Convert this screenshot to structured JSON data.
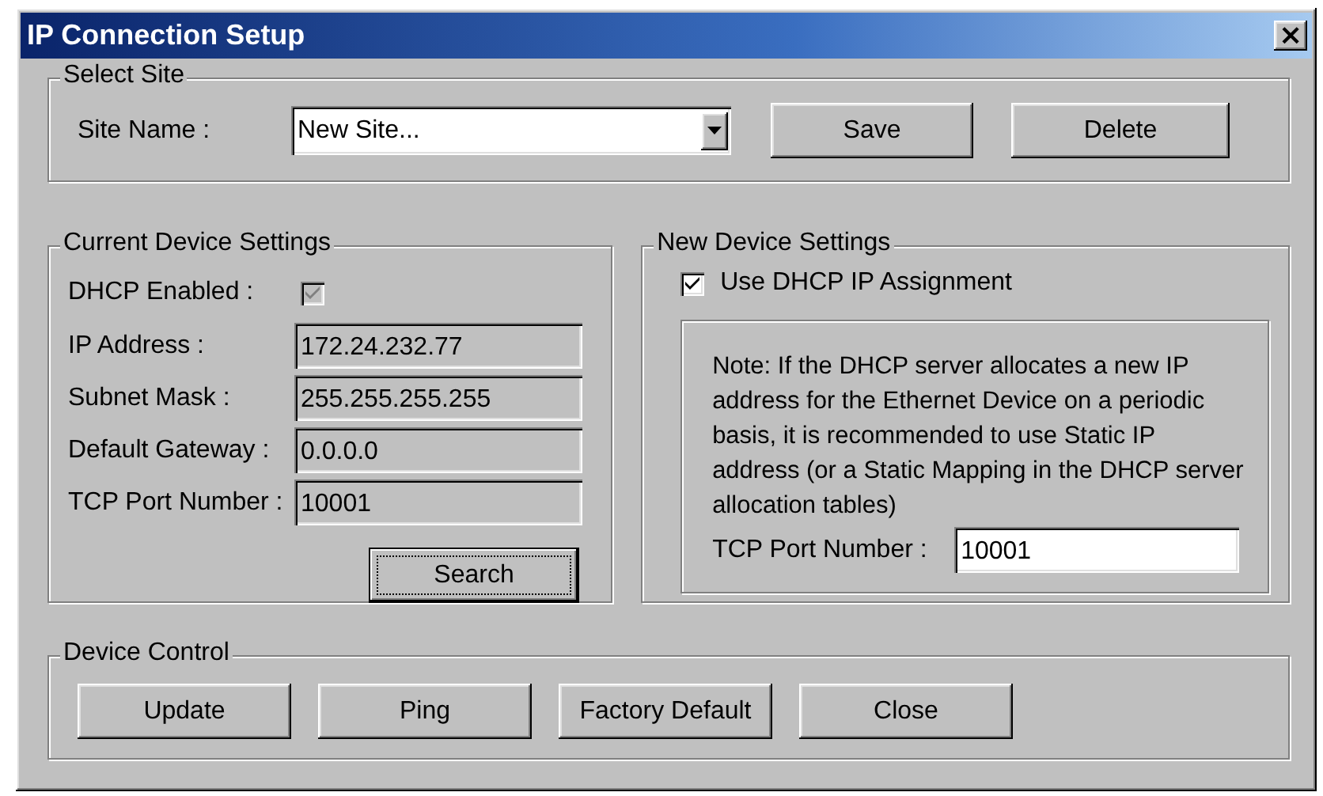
{
  "window": {
    "title": "IP Connection Setup",
    "close_glyph": "×"
  },
  "select_site": {
    "title": "Select Site",
    "site_name": {
      "label": "Site Name :",
      "value": "New Site..."
    },
    "buttons": [
      {
        "label": "Save"
      },
      {
        "label": "Delete"
      }
    ]
  },
  "current_device": {
    "title": "Current Device Settings",
    "dhcp_enabled": {
      "label": "DHCP Enabled :",
      "checked": true,
      "disabled": true
    },
    "fields": [
      {
        "label": "IP Address :",
        "value": "172.24.232.77",
        "readonly": true
      },
      {
        "label": "Subnet Mask :",
        "value": "255.255.255.255",
        "readonly": true
      },
      {
        "label": "Default Gateway :",
        "value": "0.0.0.0",
        "readonly": true
      },
      {
        "label": "TCP Port Number :",
        "value": "10001",
        "readonly": true
      }
    ],
    "search_button": {
      "label": "Search",
      "focused": true
    }
  },
  "new_device": {
    "title": "New Device Settings",
    "use_dhcp": {
      "label": "Use DHCP IP Assignment",
      "checked": true,
      "disabled": false
    },
    "note": "Note: If the DHCP server allocates a new IP address for the Ethernet Device on a periodic basis, it is recommended to use Static IP address (or a Static Mapping in the DHCP server allocation tables)",
    "tcp_port": {
      "label": "TCP Port Number :",
      "value": "10001",
      "readonly": false
    }
  },
  "device_control": {
    "title": "Device Control",
    "buttons": [
      {
        "label": "Update"
      },
      {
        "label": "Ping"
      },
      {
        "label": "Factory Default"
      },
      {
        "label": "Close"
      }
    ]
  }
}
